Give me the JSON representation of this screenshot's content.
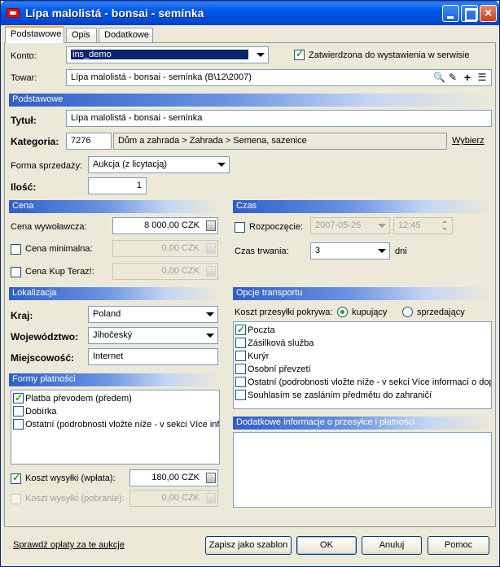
{
  "window": {
    "title": "Lípa malolistá - bonsai - semínka"
  },
  "tabs": [
    {
      "label": "Podstawowe",
      "active": true
    },
    {
      "label": "Opis"
    },
    {
      "label": "Dodatkowe"
    }
  ],
  "konto": {
    "label": "Konto:",
    "value": "ins_demo"
  },
  "approved": {
    "label": "Zatwierdzona do wystawienia w serwisie",
    "checked": true
  },
  "towar": {
    "label": "Towar:",
    "value": "Lípa malolistá - bonsai - semínka  (B\\12\\2007)"
  },
  "sections": {
    "basic": "Podstawowe",
    "price": "Cena",
    "time": "Czas",
    "location": "Lokalizacja",
    "transport": "Opcje transportu",
    "payment": "Formy płatności",
    "additional": "Dodatkowe informacje o przesyłce i płatności"
  },
  "tytul": {
    "label": "Tytuł:",
    "value": "Lípa malolistá - bonsai - semínka"
  },
  "kategoria": {
    "label": "Kategoria:",
    "id": "7276",
    "path": "Dům a zahrada > Zahrada > Semena, sazenice",
    "choose": "Wybierz"
  },
  "forma": {
    "label": "Forma sprzedaży:",
    "value": "Aukcja (z licytacją)"
  },
  "ilosc": {
    "label": "Ilość:",
    "value": "1"
  },
  "price": {
    "start_label": "Cena wywoławcza:",
    "start_value": "8 000,00 CZK",
    "min_label": "Cena minimalna:",
    "min_value": "0,00 CZK",
    "buy_label": "Cena Kup Teraz!:",
    "buy_value": "0,00 CZK"
  },
  "time": {
    "start_label": "Rozpoczęcie:",
    "date": "2007-05-25",
    "clock": "12:45",
    "duration_label": "Czas trwania:",
    "duration_value": "3",
    "duration_unit": "dni"
  },
  "location": {
    "country_label": "Kraj:",
    "country": "Poland",
    "region_label": "Województwo:",
    "region": "Jihočeský",
    "city_label": "Miejscowość:",
    "city": "Internet"
  },
  "transport": {
    "payer_label": "Koszt przesyłki pokrywa:",
    "buyer": "kupujący",
    "seller": "sprzedający",
    "options": [
      {
        "label": "Poczta",
        "checked": true
      },
      {
        "label": "Zásilková služba",
        "checked": false
      },
      {
        "label": "Kurýr",
        "checked": false
      },
      {
        "label": "Osobní převzetí",
        "checked": false
      },
      {
        "label": "Ostatní (podrobnosti vložte níže - v sekci Více informací o dopr",
        "checked": false
      },
      {
        "label": "Souhlasím se zasláním předmětu do zahraničí",
        "checked": false
      }
    ]
  },
  "payment": {
    "options": [
      {
        "label": "Platba převodem (předem)",
        "checked": true
      },
      {
        "label": "Dobírka",
        "checked": false
      },
      {
        "label": "Ostatní (podrobnosti vložte níže - v sekci Více infor",
        "checked": false
      }
    ],
    "ship_prepaid_label": "Koszt wysyłki (wpłata):",
    "ship_prepaid_value": "180,00 CZK",
    "ship_cod_label": "Koszt wysyłki (pobranie):",
    "ship_cod_value": "0,00 CZK"
  },
  "footer": {
    "check_fees": "Sprawdź opłaty za te aukcje",
    "save_template": "Zapisz jako szablon",
    "ok": "OK",
    "cancel": "Anuluj",
    "help": "Pomoc"
  },
  "colors": {
    "title_bar": "#0054e3",
    "section_header": "#2f5ec8",
    "selection": "#0b246b",
    "window_bg": "#ece9d8"
  }
}
